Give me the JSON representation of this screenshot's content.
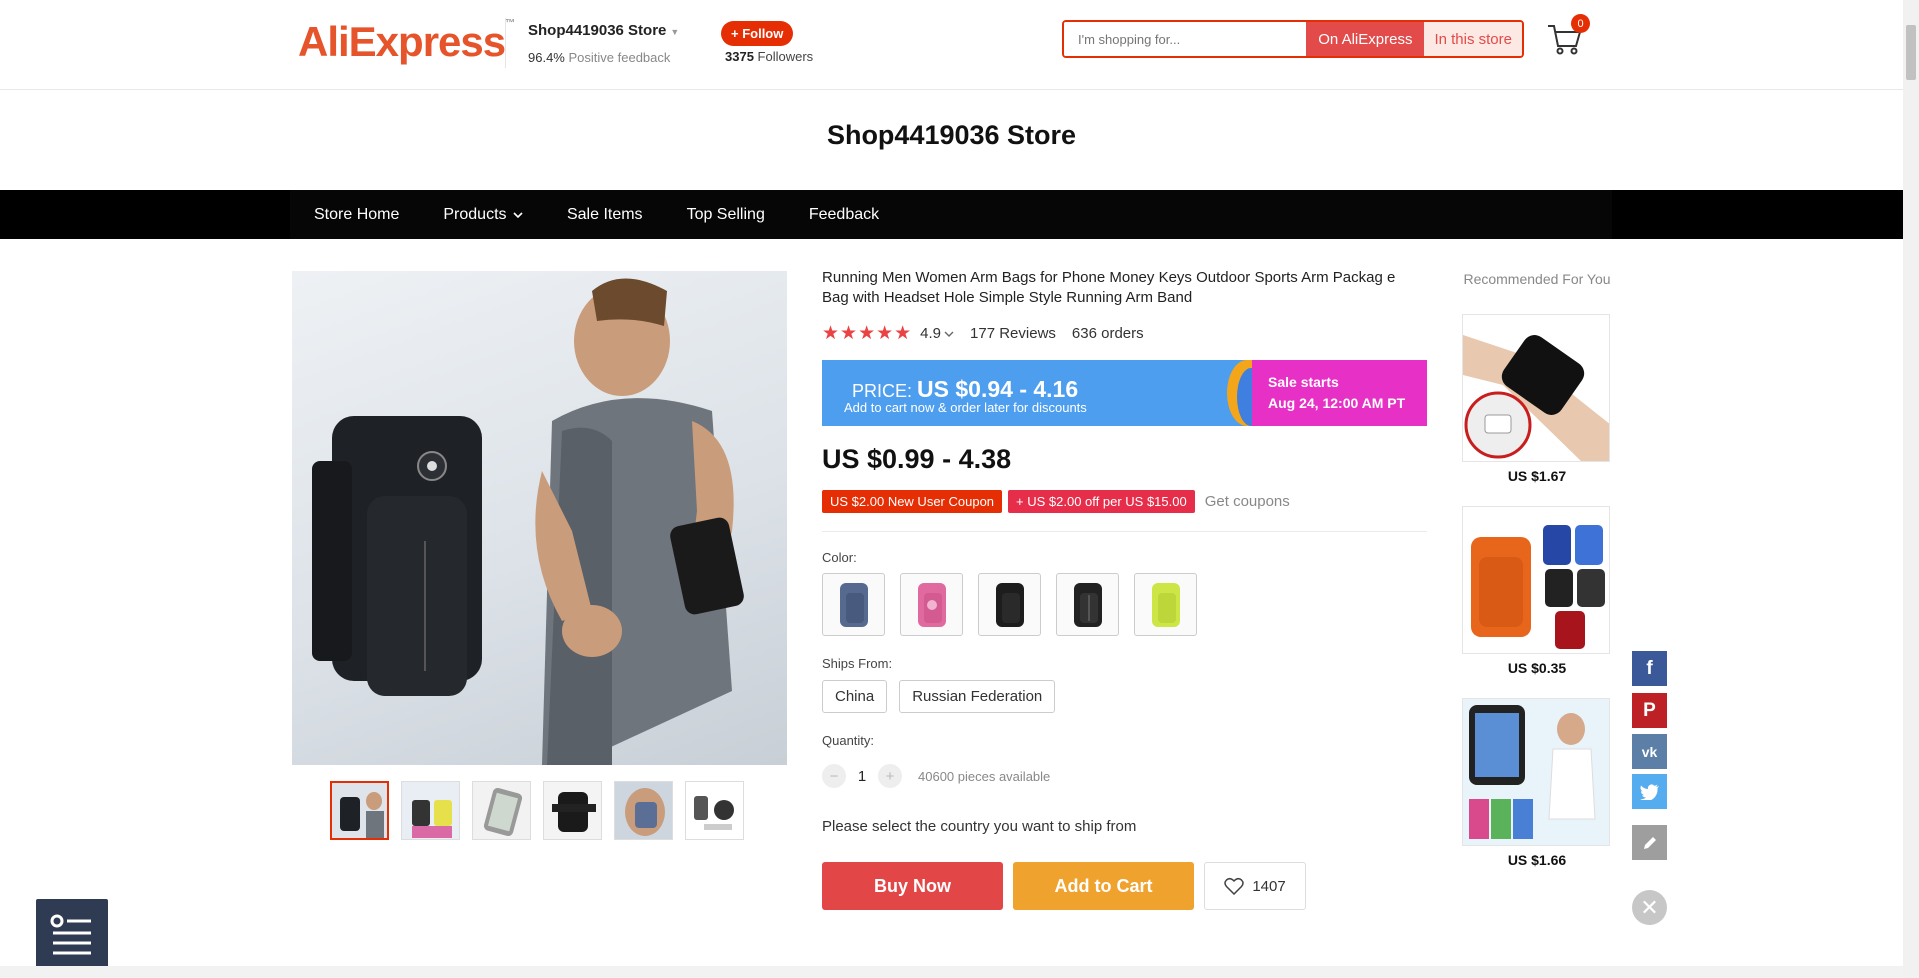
{
  "header": {
    "logo_ali": "Ali",
    "logo_express": "Express",
    "logo_tm": "™",
    "store_name": "Shop4419036 Store",
    "feedback_pct": "96.4%",
    "feedback_label": "Positive feedback",
    "follow_label": "+ Follow",
    "followers_count": "3375",
    "followers_label": "Followers",
    "search_placeholder": "I'm shopping for...",
    "search_on_label": "On AliExpress",
    "search_in_label": "In this store",
    "cart_count": "0"
  },
  "store_title": "Shop4419036 Store",
  "nav": [
    {
      "label": "Store Home"
    },
    {
      "label": "Products"
    },
    {
      "label": "Sale Items"
    },
    {
      "label": "Top Selling"
    },
    {
      "label": "Feedback"
    }
  ],
  "product": {
    "title": "Running Men Women Arm Bags for Phone Money Keys Outdoor Sports Arm Packag e Bag with Headset Hole Simple Style Running Arm Band",
    "rating": "4.9",
    "reviews": "177 Reviews",
    "orders": "636 orders",
    "banner_price_label": "PRICE:",
    "banner_price": "US $0.94 - 4.16",
    "banner_sub": "Add to cart now & order later for discounts",
    "sale_line1": "Sale starts",
    "sale_line2": "Aug 24, 12:00 AM PT",
    "price": "US $0.99 - 4.38",
    "coupon1": "US $2.00 New User Coupon",
    "coupon2": "+ US $2.00 off per US $15.00",
    "get_coupons": "Get coupons",
    "color_label": "Color:",
    "ships_label": "Ships From:",
    "ships_options": [
      "China",
      "Russian Federation"
    ],
    "quantity_label": "Quantity:",
    "quantity_value": "1",
    "available": "40600 pieces available",
    "country_msg": "Please select the country you want to ship from",
    "buy_now": "Buy Now",
    "add_to_cart": "Add to Cart",
    "wishlist_count": "1407"
  },
  "recommended": {
    "title": "Recommended For You",
    "items": [
      {
        "price": "US $1.67"
      },
      {
        "price": "US $0.35"
      },
      {
        "price": "US $1.66"
      }
    ]
  },
  "colors": {
    "accent": "#e62e04",
    "buy": "#e34646",
    "cart": "#f0a22e",
    "banner": "#4e9ef0",
    "sale": "#e730c6"
  }
}
